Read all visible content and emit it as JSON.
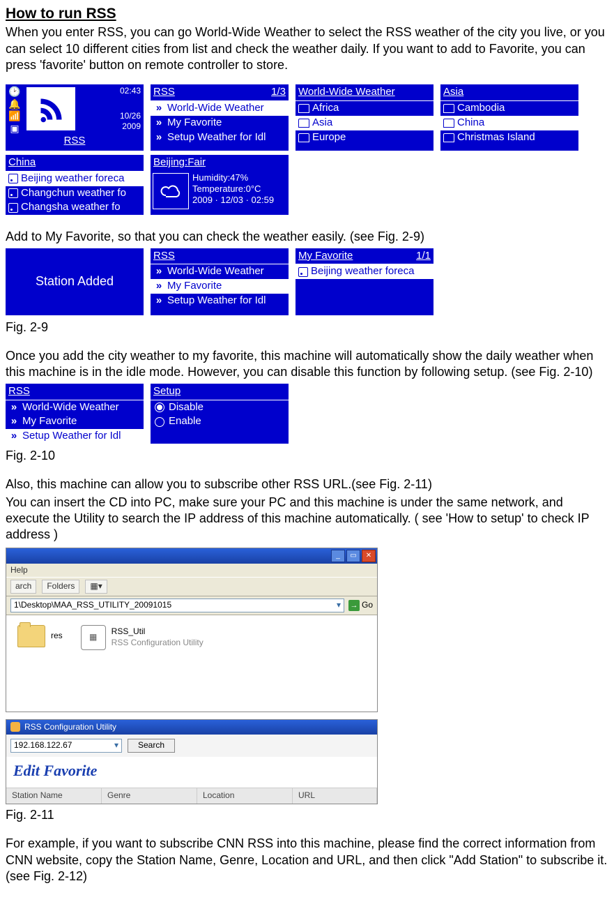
{
  "heading": "How to run RSS",
  "intro_para": "When you enter RSS, you can go World-Wide Weather to select the RSS weather of the city you live, or you can select 10 different cities from list and check the weather daily. If you want to add to Favorite, you can press 'favorite' button on remote controller to store.",
  "row1": {
    "tile": {
      "time": "02:43",
      "date1": "10/26",
      "date2": "2009",
      "label": "RSS"
    },
    "panel2": {
      "title_left": "RSS",
      "title_right": "1/3",
      "items": [
        "World-Wide Weather",
        "My Favorite",
        "Setup Weather for Idl"
      ]
    },
    "panel3": {
      "title": "World-Wide Weather",
      "items": [
        "Africa",
        "Asia",
        "Europe"
      ]
    },
    "panel4": {
      "title": "Asia",
      "items": [
        "Cambodia",
        "China",
        "Christmas Island"
      ]
    },
    "panel5": {
      "title": "China",
      "items": [
        "Beijing weather foreca",
        "Changchun weather fo",
        "Changsha weather fo"
      ]
    },
    "wx": {
      "head": "Beijing:Fair",
      "humidity": "Humidity:47%",
      "temp": "Temperature:0°C",
      "stamp": "2009 · 12/03 · 02:59"
    }
  },
  "fav_para": "Add to My Favorite, so that you can check the weather easily. (see Fig. 2-9)",
  "row2": {
    "added": "Station Added",
    "panel2": {
      "title": "RSS",
      "items": [
        "World-Wide Weather",
        "My Favorite",
        "Setup Weather for Idl"
      ]
    },
    "panel3": {
      "title_left": "My Favorite",
      "title_right": "1/1",
      "item": "Beijing weather foreca"
    }
  },
  "fig29": "Fig. 2-9",
  "idle_para": "Once you add the city weather to my favorite, this machine will automatically show the daily weather when this machine is in the idle mode. However, you can disable this function by following setup. (see Fig. 2-10)",
  "row3": {
    "panel1": {
      "title": "RSS",
      "items": [
        "World-Wide Weather",
        "My Favorite",
        "Setup Weather for Idl"
      ]
    },
    "panel2": {
      "title": "Setup",
      "disable": "Disable",
      "enable": "Enable"
    }
  },
  "fig210": "Fig. 2-10",
  "sub_para1": "Also, this machine can allow you to subscribe other RSS URL.(see Fig. 2-11)",
  "sub_para2": "You can insert the CD into PC, make sure your PC and this machine is under the same network, and execute the Utility to search the IP address of this machine automatically. ( see 'How to setup' to check IP address )",
  "explorer": {
    "menu_help": "Help",
    "tool_search": "arch",
    "tool_folders": "Folders",
    "addr_path": "1\\Desktop\\MAA_RSS_UTILITY_20091015",
    "go": "Go",
    "folder_name": "res",
    "file_name": "RSS_Util",
    "file_sub": "RSS Configuration Utility"
  },
  "util": {
    "title": "RSS Configuration Utility",
    "ip": "192.168.122.67",
    "search": "Search",
    "edit_fav": "Edit Favorite",
    "col_station": "Station Name",
    "col_genre": "Genre",
    "col_location": "Location",
    "col_url": "URL"
  },
  "fig211": "Fig. 2-11",
  "cnn_para": "For example, if you want to subscribe CNN RSS into this machine, please find the correct information from CNN website, copy the Station Name, Genre, Location and URL, and then click \"Add Station\" to subscribe it. (see Fig. 2-12)"
}
